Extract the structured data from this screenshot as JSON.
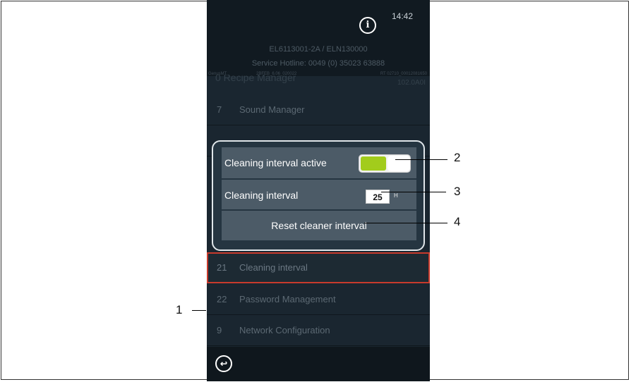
{
  "status": {
    "time": "14:42",
    "info_icon": "info-icon"
  },
  "header": {
    "device_id": "EL6113001-2A / ELN130000",
    "service_hotline": "Service Hotline: 0049 (0) 35023 63888",
    "tiny_left": "GenusMT",
    "tiny_mid": "2BFEB_6.06_020022",
    "tiny_right": "RT 02710_00012081650",
    "partial_item": "0 Recipe Manager",
    "partial_right": "102.0A0I"
  },
  "menu": {
    "items": [
      {
        "num": "7",
        "label": "Sound Manager"
      },
      {
        "num": "",
        "label": ""
      },
      {
        "num": "21",
        "label": "Cleaning interval"
      },
      {
        "num": "22",
        "label": "Password Management"
      },
      {
        "num": "9",
        "label": "Network Configuration"
      }
    ]
  },
  "dialog": {
    "active_label": "Cleaning interval active",
    "active_state": "on",
    "interval_label": "Cleaning interval",
    "interval_value": "25",
    "interval_unit": "H",
    "reset_label": "Reset cleaner interval"
  },
  "callouts": {
    "c1": "1",
    "c2": "2",
    "c3": "3",
    "c4": "4"
  },
  "colors": {
    "accent_green": "#a2cc1c",
    "selection_red": "#c83a2c",
    "background": "#1a2630"
  }
}
